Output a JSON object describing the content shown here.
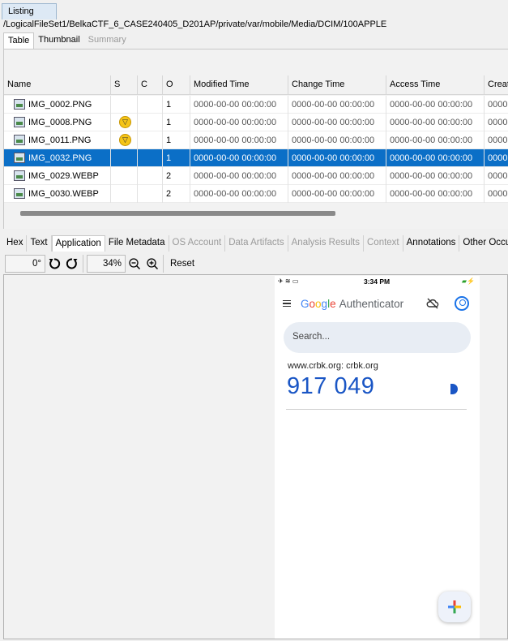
{
  "listing_tab": "Listing",
  "path": "/LogicalFileSet1/BelkaCTF_6_CASE240405_D201AP/private/var/mobile/Media/DCIM/100APPLE",
  "view_tabs": [
    {
      "label": "Table"
    },
    {
      "label": "Thumbnail"
    },
    {
      "label": "Summary"
    }
  ],
  "columns": [
    "Name",
    "S",
    "C",
    "O",
    "Modified Time",
    "Change Time",
    "Access Time",
    "Creat"
  ],
  "rows": [
    {
      "name": "IMG_0002.PNG",
      "s": "",
      "c": "",
      "o": "1",
      "modified": "0000-00-00 00:00:00",
      "change": "0000-00-00 00:00:00",
      "access": "0000-00-00 00:00:00",
      "created": "0000-"
    },
    {
      "name": "IMG_0008.PNG",
      "s": "tag",
      "c": "",
      "o": "1",
      "modified": "0000-00-00 00:00:00",
      "change": "0000-00-00 00:00:00",
      "access": "0000-00-00 00:00:00",
      "created": "0000-"
    },
    {
      "name": "IMG_0011.PNG",
      "s": "tag",
      "c": "",
      "o": "1",
      "modified": "0000-00-00 00:00:00",
      "change": "0000-00-00 00:00:00",
      "access": "0000-00-00 00:00:00",
      "created": "0000-"
    },
    {
      "name": "IMG_0032.PNG",
      "s": "",
      "c": "",
      "o": "1",
      "modified": "0000-00-00 00:00:00",
      "change": "0000-00-00 00:00:00",
      "access": "0000-00-00 00:00:00",
      "created": "0000-"
    },
    {
      "name": "IMG_0029.WEBP",
      "s": "",
      "c": "",
      "o": "2",
      "modified": "0000-00-00 00:00:00",
      "change": "0000-00-00 00:00:00",
      "access": "0000-00-00 00:00:00",
      "created": "0000-"
    },
    {
      "name": "IMG_0030.WEBP",
      "s": "",
      "c": "",
      "o": "2",
      "modified": "0000-00-00 00:00:00",
      "change": "0000-00-00 00:00:00",
      "access": "0000-00-00 00:00:00",
      "created": "0000-"
    }
  ],
  "selected_row": 3,
  "content_tabs": [
    {
      "label": "Hex"
    },
    {
      "label": "Text"
    },
    {
      "label": "Application"
    },
    {
      "label": "File Metadata"
    },
    {
      "label": "OS Account"
    },
    {
      "label": "Data Artifacts"
    },
    {
      "label": "Analysis Results"
    },
    {
      "label": "Context"
    },
    {
      "label": "Annotations"
    },
    {
      "label": "Other Occurr"
    }
  ],
  "toolbar": {
    "rotation": "0°",
    "zoom": "34%",
    "reset_label": "Reset"
  },
  "phone": {
    "status_time": "3:34 PM",
    "app_title_rest": "Authenticator",
    "search_placeholder": "Search...",
    "account": "www.crbk.org: crbk.org",
    "code": "917 049"
  },
  "colors": {
    "selection": "#0b6fc7",
    "code_blue": "#1a56c5",
    "tag_yellow": "#f5c518"
  }
}
